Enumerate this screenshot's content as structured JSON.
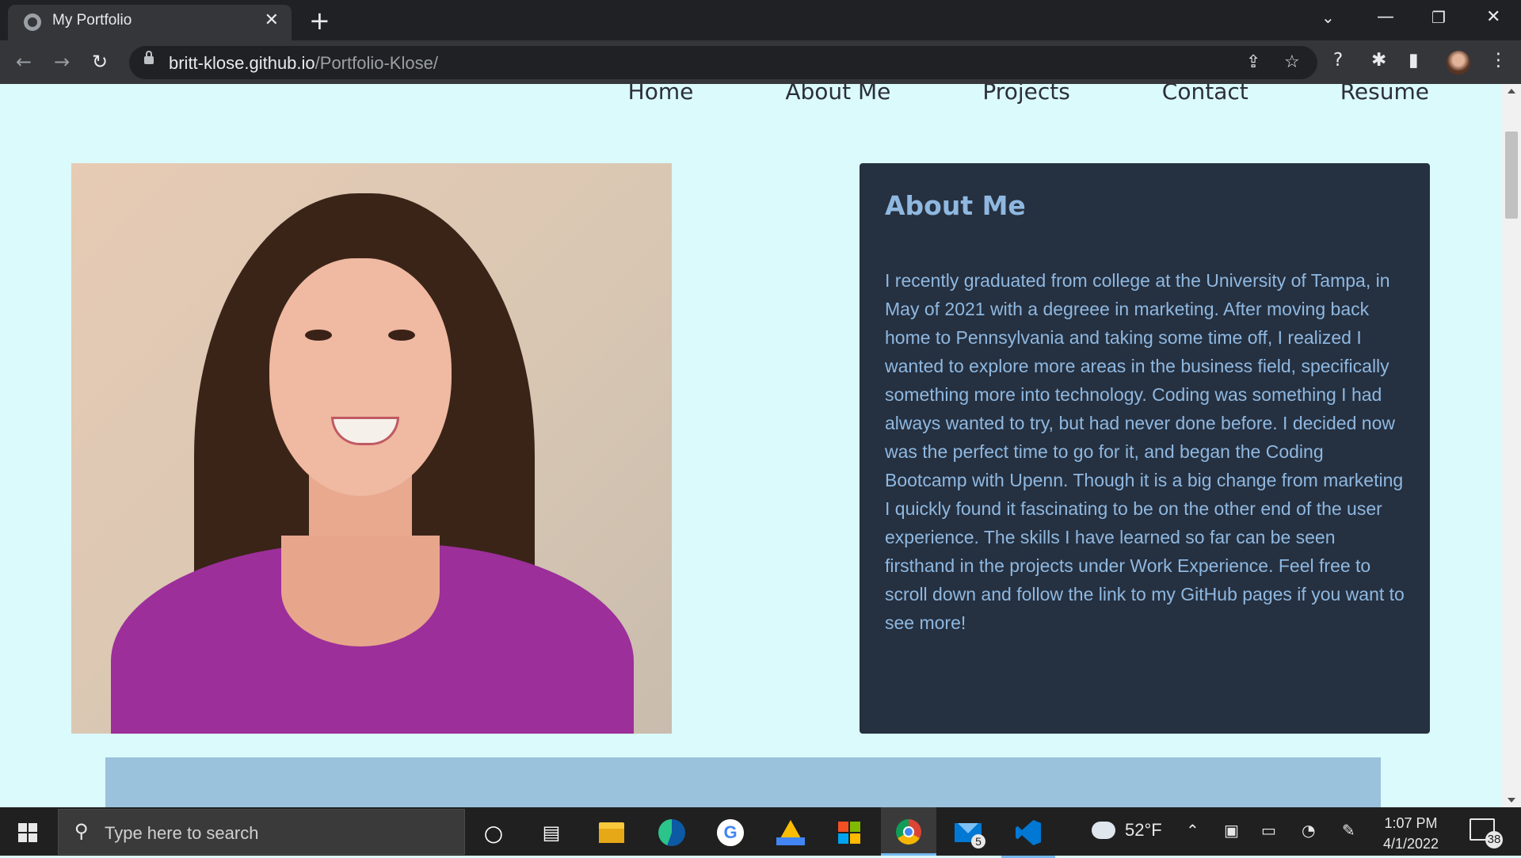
{
  "browser": {
    "tab_title": "My Portfolio",
    "url_host": "britt-klose.github.io",
    "url_path": "/Portfolio-Klose/"
  },
  "nav": {
    "items": [
      "Home",
      "About Me",
      "Projects",
      "Contact",
      "Resume"
    ]
  },
  "about": {
    "title": "About Me",
    "body": "I recently graduated from college at the University of Tampa, in May of 2021 with a degreee in marketing. After moving back home to Pennsylvania and taking some time off, I realized I wanted to explore more areas in the business field, specifically something more into technology. Coding was something I had always wanted to try, but had never done before. I decided now was the perfect time to go for it, and began the Coding Bootcamp with Upenn. Though it is a big change from marketing I quickly found it fascinating to be on the other end of the user experience. The skills I have learned so far can be seen firsthand in the projects under Work Experience. Feel free to scroll down and follow the link to my GitHub pages if you want to see more!"
  },
  "taskbar": {
    "search_placeholder": "Type here to search",
    "weather_temp": "52°F",
    "mail_badge": "5",
    "time": "1:07 PM",
    "date": "4/1/2022",
    "notification_count": "38"
  },
  "colors": {
    "page_bg": "#dbfafb",
    "card_bg": "#253040",
    "card_text": "#8fb8e0",
    "section_bg": "#9ac2dc"
  }
}
